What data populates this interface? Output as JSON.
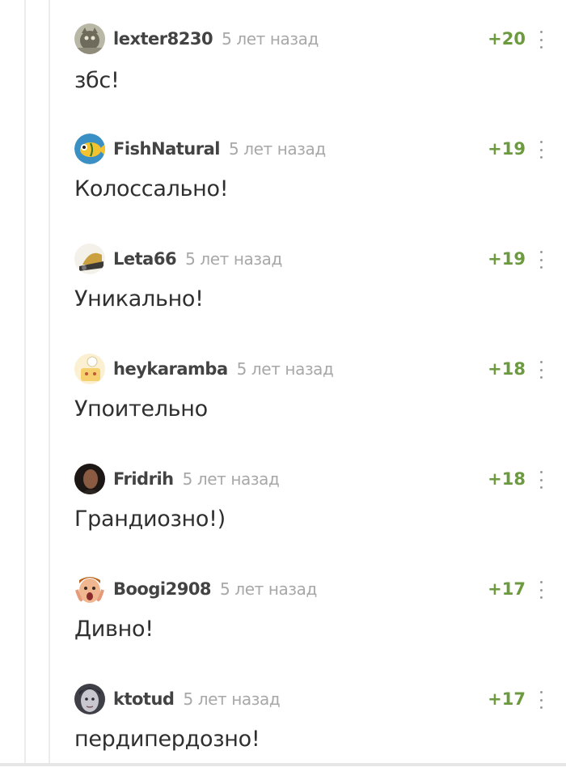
{
  "colors": {
    "username": "#434343",
    "time": "#a8a8a8",
    "rating": "#6c9a3e",
    "text": "#2f2f2f",
    "thread_line": "#ececec"
  },
  "comments": [
    {
      "username": "lexter8230",
      "time": "5 лет назад",
      "rating": "+20",
      "text": "збс!",
      "avatar_icon": "cat-avatar-icon"
    },
    {
      "username": "FishNatural",
      "time": "5 лет назад",
      "rating": "+19",
      "text": "Колоссально!",
      "avatar_icon": "fish-avatar-icon"
    },
    {
      "username": "Leta66",
      "time": "5 лет назад",
      "rating": "+19",
      "text": "Уникально!",
      "avatar_icon": "photo-avatar-icon"
    },
    {
      "username": "heykaramba",
      "time": "5 лет назад",
      "rating": "+18",
      "text": "Упоительно",
      "avatar_icon": "cartoon-avatar-icon"
    },
    {
      "username": "Fridrih",
      "time": "5 лет назад",
      "rating": "+18",
      "text": "Грандиозно!)",
      "avatar_icon": "portrait-avatar-icon"
    },
    {
      "username": "Boogi2908",
      "time": "5 лет назад",
      "rating": "+17",
      "text": "Дивно!",
      "avatar_icon": "kid-face-avatar-icon"
    },
    {
      "username": "ktotud",
      "time": "5 лет назад",
      "rating": "+17",
      "text": "пердипердозно!",
      "avatar_icon": "face-avatar-icon"
    }
  ]
}
